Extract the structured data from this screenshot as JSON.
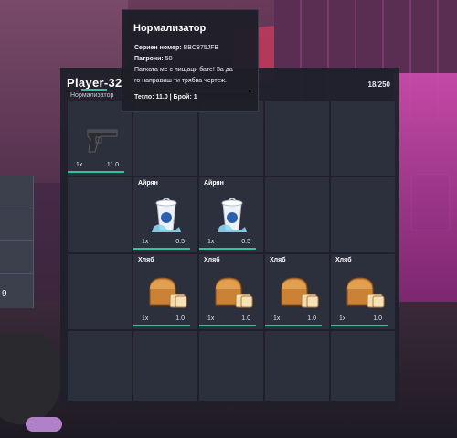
{
  "inventory": {
    "player_name": "Player-32",
    "tab_label": "Нормализатор",
    "capacity": "18/250",
    "accent_color": "#2ec4a0",
    "slots": [
      {
        "label": "",
        "icon": "pistol-icon",
        "qty": "1x",
        "weight": "11.0"
      },
      {
        "label": "Айрян",
        "icon": "ayran-cup-icon",
        "qty": "1x",
        "weight": "0.5"
      },
      {
        "label": "Айрян",
        "icon": "ayran-cup-icon",
        "qty": "1x",
        "weight": "0.5"
      },
      {
        "label": "Хляб",
        "icon": "bread-icon",
        "qty": "1x",
        "weight": "1.0"
      },
      {
        "label": "Хляб",
        "icon": "bread-icon",
        "qty": "1x",
        "weight": "1.0"
      },
      {
        "label": "Хляб",
        "icon": "bread-icon",
        "qty": "1x",
        "weight": "1.0"
      },
      {
        "label": "Хляб",
        "icon": "bread-icon",
        "qty": "1x",
        "weight": "1.0"
      }
    ]
  },
  "tooltip": {
    "title": "Нормализатор",
    "serial_label": "Сериен номер:",
    "serial_value": "BBC875JFB",
    "ammo_label": "Патрони:",
    "ammo_value": "50",
    "description_1": "Патката ме с пищаци бате! За да",
    "description_2": "го направиш ти трябва чертеж.",
    "footer": "Тегло: 11.0 | Брой: 1"
  },
  "background": {
    "side_number": "9"
  }
}
